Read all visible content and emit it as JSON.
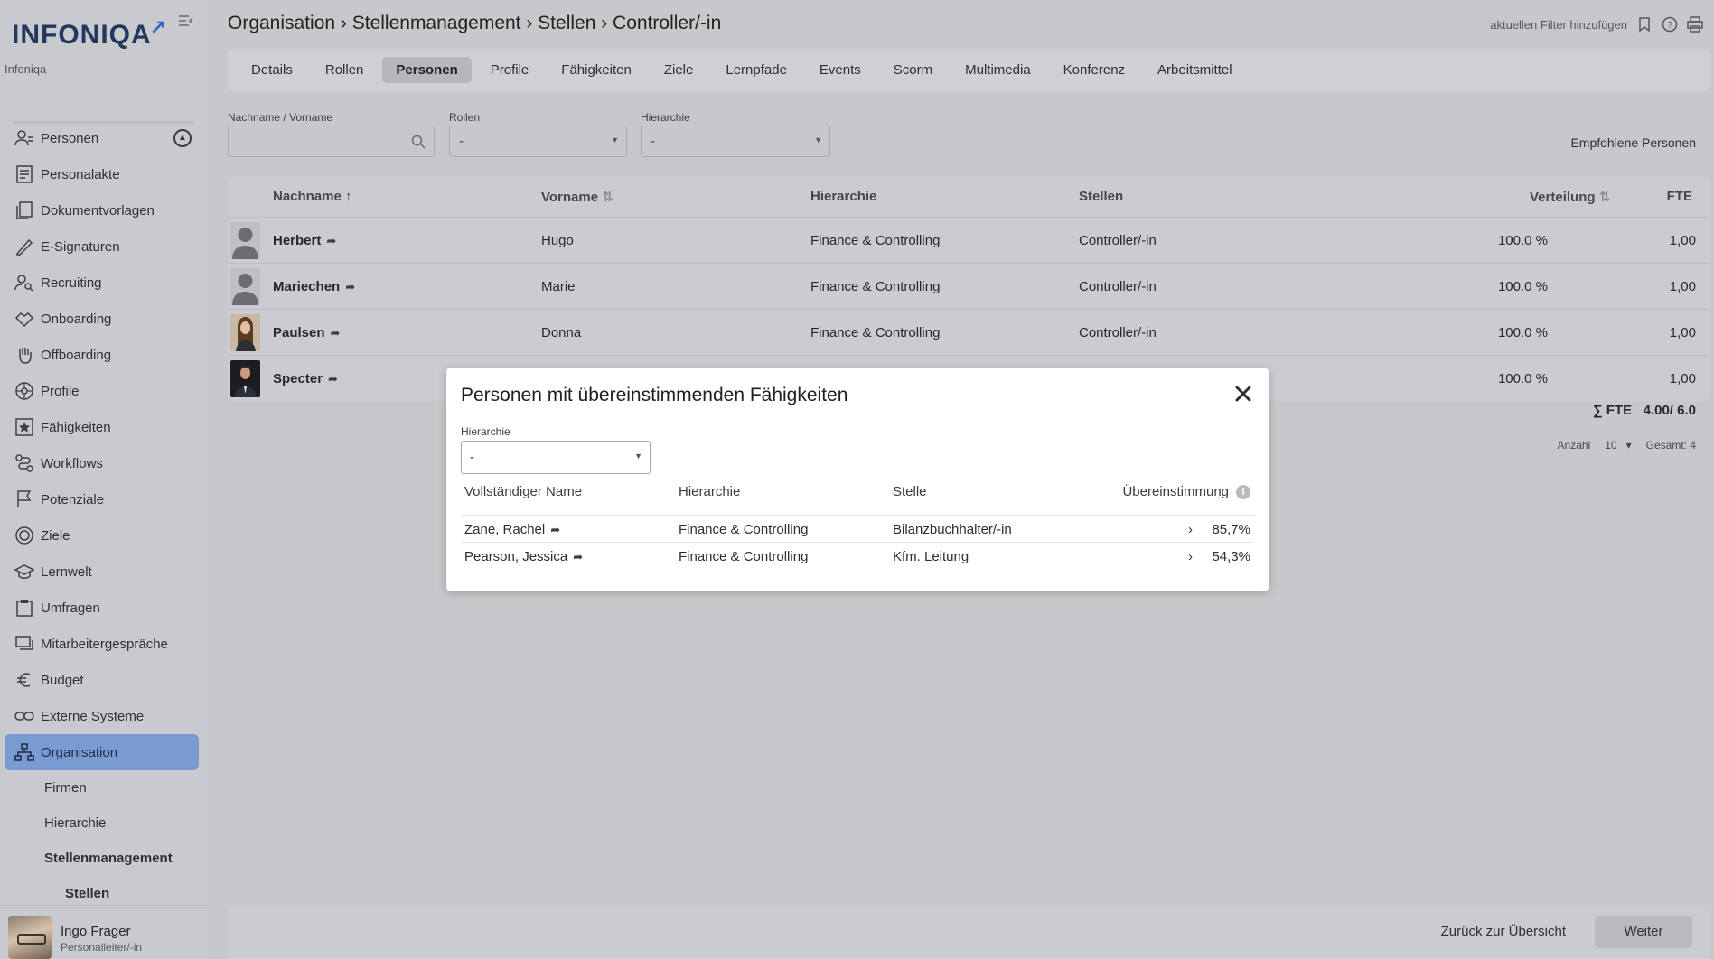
{
  "brand": {
    "logo": "INFONIQA",
    "tenant": "Infoniqa"
  },
  "sidebar": {
    "items": [
      {
        "label": "Personen",
        "icon": "users-icon"
      },
      {
        "label": "Personalakte",
        "icon": "file-list-icon"
      },
      {
        "label": "Dokumentvorlagen",
        "icon": "documents-icon"
      },
      {
        "label": "E-Signaturen",
        "icon": "pen-icon"
      },
      {
        "label": "Recruiting",
        "icon": "user-search-icon"
      },
      {
        "label": "Onboarding",
        "icon": "handshake-icon"
      },
      {
        "label": "Offboarding",
        "icon": "hand-icon"
      },
      {
        "label": "Profile",
        "icon": "network-icon"
      },
      {
        "label": "Fähigkeiten",
        "icon": "star-icon"
      },
      {
        "label": "Workflows",
        "icon": "workflow-icon"
      },
      {
        "label": "Potenziale",
        "icon": "flag-icon"
      },
      {
        "label": "Ziele",
        "icon": "target-icon"
      },
      {
        "label": "Lernwelt",
        "icon": "graduation-cap-icon"
      },
      {
        "label": "Umfragen",
        "icon": "clipboard-icon"
      },
      {
        "label": "Mitarbeitergespräche",
        "icon": "chat-icon"
      },
      {
        "label": "Budget",
        "icon": "euro-icon"
      },
      {
        "label": "Externe Systeme",
        "icon": "link-icon"
      },
      {
        "label": "Organisation",
        "icon": "org-chart-icon"
      }
    ],
    "subitems": [
      "Firmen",
      "Hierarchie",
      "Stellenmanagement"
    ],
    "subsubitem": "Stellen",
    "user": {
      "name": "Ingo Frager",
      "role": "Personalleiter/-in"
    }
  },
  "header": {
    "breadcrumb": "Organisation › Stellenmanagement › Stellen › Controller/-in",
    "filter_link": "aktuellen Filter hinzufügen"
  },
  "tabs": [
    "Details",
    "Rollen",
    "Personen",
    "Profile",
    "Fähigkeiten",
    "Ziele",
    "Lernpfade",
    "Events",
    "Scorm",
    "Multimedia",
    "Konferenz",
    "Arbeitsmittel"
  ],
  "filters": {
    "name_label": "Nachname / Vorname",
    "name_value": "",
    "roles_label": "Rollen",
    "roles_value": "-",
    "hierarchy_label": "Hierarchie",
    "hierarchy_value": "-",
    "recommended": "Empfohlene Personen"
  },
  "table": {
    "headers": {
      "lastname": "Nachname",
      "firstname": "Vorname",
      "hierarchy": "Hierarchie",
      "positions": "Stellen",
      "distribution": "Verteilung",
      "fte": "FTE"
    },
    "rows": [
      {
        "lastname": "Herbert",
        "firstname": "Hugo",
        "hierarchy": "Finance & Controlling",
        "position": "Controller/-in",
        "distribution": "100.0 %",
        "fte": "1,00"
      },
      {
        "lastname": "Mariechen",
        "firstname": "Marie",
        "hierarchy": "Finance & Controlling",
        "position": "Controller/-in",
        "distribution": "100.0 %",
        "fte": "1,00"
      },
      {
        "lastname": "Paulsen",
        "firstname": "Donna",
        "hierarchy": "Finance & Controlling",
        "position": "Controller/-in",
        "distribution": "100.0 %",
        "fte": "1,00"
      },
      {
        "lastname": "Specter",
        "firstname": "",
        "hierarchy": "",
        "position": "",
        "distribution": "100.0 %",
        "fte": "1,00"
      }
    ],
    "fte_sum": "∑ FTE   4.00/ 6.0",
    "count_label": "Anzahl",
    "count_value": "10",
    "total": "Gesamt: 4"
  },
  "modal": {
    "title": "Personen mit übereinstimmenden Fähigkeiten",
    "hierarchy_label": "Hierarchie",
    "hierarchy_value": "-",
    "headers": {
      "name": "Vollständiger Name",
      "hierarchy": "Hierarchie",
      "position": "Stelle",
      "match": "Übereinstimmung"
    },
    "rows": [
      {
        "name": "Zane, Rachel",
        "hierarchy": "Finance & Controlling",
        "position": "Bilanzbuchhalter/-in",
        "match": "85,7%"
      },
      {
        "name": "Pearson, Jessica",
        "hierarchy": "Finance & Controlling",
        "position": "Kfm. Leitung",
        "match": "54,3%"
      }
    ]
  },
  "footer": {
    "back": "Zurück zur Übersicht",
    "next": "Weiter"
  },
  "colors": {
    "accent": "#7a9bd2",
    "logo": "#23385e",
    "overlay_bg": "#c7c8cb",
    "modal_bg": "#ffffff"
  }
}
